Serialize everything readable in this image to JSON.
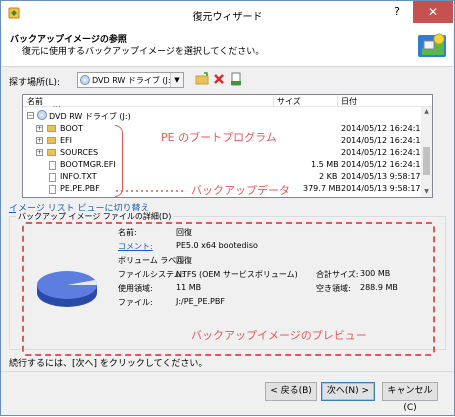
{
  "window": {
    "title": "復元ウィザード",
    "help_label": "?",
    "close_label": "✕"
  },
  "header": {
    "title": "バックアップイメージの参照",
    "subtitle": "復元に使用するバックアップイメージを選択してください。"
  },
  "search": {
    "label": "探す場所(L):",
    "value": "DVD RW ドライブ (J:)"
  },
  "filelist": {
    "columns": [
      "名前",
      "サイズ",
      "日付"
    ],
    "partial_top": "...",
    "rows": [
      {
        "name": "DVD RW ドライブ (J:)",
        "size": "",
        "date": "",
        "type": "drive",
        "indent": 0
      },
      {
        "name": "BOOT",
        "size": "",
        "date": "2014/05/12 16:24:15",
        "type": "folder",
        "indent": 1
      },
      {
        "name": "EFI",
        "size": "",
        "date": "2014/05/12 16:24:14",
        "type": "folder",
        "indent": 1
      },
      {
        "name": "SOURCES",
        "size": "",
        "date": "2014/05/12 16:24:14",
        "type": "folder",
        "indent": 1
      },
      {
        "name": "BOOTMGR.EFI",
        "size": "1.5 MB",
        "date": "2014/05/12 16:24:15",
        "type": "file",
        "indent": 1
      },
      {
        "name": "INFO.TXT",
        "size": "2 KB",
        "date": "2014/05/13 9:58:17",
        "type": "file",
        "indent": 1
      },
      {
        "name": "PE.PE.PBF",
        "size": "379.7 MB",
        "date": "2014/05/13 9:58:17",
        "type": "file",
        "indent": 1
      }
    ]
  },
  "annotations": {
    "boot_program": "PE のブートプログラム",
    "backup_data": "バックアップデータ",
    "preview": "バックアップイメージのプレビュー"
  },
  "link_label": "イメージ リスト ビューに切り替え",
  "details": {
    "group_title": "バックアップ イメージ ファイルの詳細(D)",
    "fields": [
      {
        "key": "名前:",
        "value": "回復",
        "link": false
      },
      {
        "key": "コメント:",
        "value": "PE5.0 x64 bootediso",
        "link": true
      },
      {
        "key": "ボリューム ラベル:",
        "value": "回復",
        "link": false
      },
      {
        "key": "ファイルシステム:",
        "value": "NTFS (OEM サービスボリューム)",
        "link": false
      },
      {
        "key": "使用領域:",
        "value": "11 MB",
        "link": false
      },
      {
        "key": "ファイル:",
        "value": "J:/PE_PE.PBF",
        "link": false
      }
    ],
    "total_size_label": "合計サイズ:",
    "total_size_value": "300 MB",
    "free_label": "空き領域:",
    "free_value": "288.9 MB"
  },
  "status_text": "続行するには、[次へ] をクリックしてください。",
  "buttons": {
    "back": "< 戻る(B)",
    "next": "次へ(N) >",
    "cancel": "キャンセル(C)"
  },
  "colors": {
    "annotation": "#e05a5a",
    "pie_top": "#5d7ee0",
    "pie_side": "#2a4aa8"
  },
  "icons": {
    "app": "restore-wizard-icon",
    "header": "backup-tool-icon",
    "combo": "cd-drive-icon",
    "toolbar": [
      "new-folder-icon",
      "delete-icon",
      "properties-icon"
    ]
  }
}
